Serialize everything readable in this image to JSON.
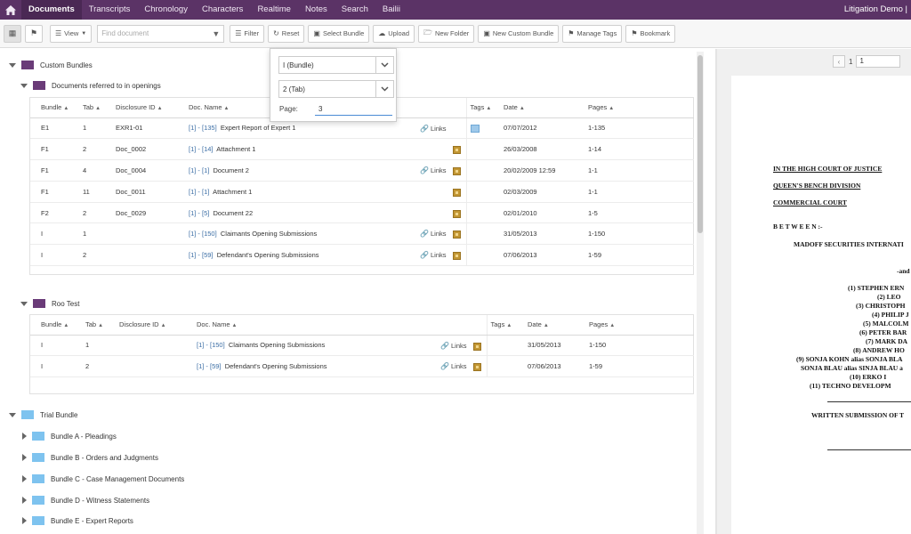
{
  "nav": {
    "items": [
      "Documents",
      "Transcripts",
      "Chronology",
      "Characters",
      "Realtime",
      "Notes",
      "Search",
      "Bailii"
    ],
    "active": "Documents",
    "right_label": "Litigation Demo |"
  },
  "toolbar": {
    "view_label": "View",
    "search_placeholder": "Find document",
    "filter_label": "Filter",
    "reset_label": "Reset",
    "select_bundle_label": "Select Bundle",
    "upload_label": "Upload",
    "new_folder_label": "New Folder",
    "new_custom_bundle_label": "New Custom Bundle",
    "manage_tags_label": "Manage Tags",
    "bookmark_label": "Bookmark"
  },
  "popup": {
    "bundle_value": "I (Bundle)",
    "tab_value": "2 (Tab)",
    "page_label": "Page:",
    "page_value": "3"
  },
  "tree": {
    "custom_bundles": "Custom Bundles",
    "docs_in_openings": "Documents referred to in openings",
    "roo_test": "Roo Test",
    "trial_bundle": "Trial Bundle",
    "sub_bundles": [
      "Bundle A - Pleadings",
      "Bundle B - Orders and Judgments",
      "Bundle C - Case Management Documents",
      "Bundle D - Witness Statements",
      "Bundle E - Expert Reports"
    ]
  },
  "table_headers": {
    "bundle": "Bundle",
    "tab": "Tab",
    "disclosure_id": "Disclosure ID",
    "doc_name": "Doc. Name",
    "tags": "Tags",
    "date": "Date",
    "pages": "Pages",
    "links": "Links"
  },
  "table1_rows": [
    {
      "bundle": "E1",
      "tab": "1",
      "disclosure": "EXR1-01",
      "ref": "[1] - [135]",
      "name": "Expert Report of Expert 1",
      "links": true,
      "tag": "blue",
      "date": "07/07/2012",
      "pages": "1-135"
    },
    {
      "bundle": "F1",
      "tab": "2",
      "disclosure": "Doc_0002",
      "ref": "[1] - [14]",
      "name": "Attachment 1",
      "links": false,
      "tag": "gold",
      "date": "26/03/2008",
      "pages": "1-14"
    },
    {
      "bundle": "F1",
      "tab": "4",
      "disclosure": "Doc_0004",
      "ref": "[1] - [1]",
      "name": "Document 2",
      "links": true,
      "tag": "gold",
      "date": "20/02/2009 12:59",
      "pages": "1-1"
    },
    {
      "bundle": "F1",
      "tab": "11",
      "disclosure": "Doc_0011",
      "ref": "[1] - [1]",
      "name": "Attachment 1",
      "links": false,
      "tag": "gold",
      "date": "02/03/2009",
      "pages": "1-1"
    },
    {
      "bundle": "F2",
      "tab": "2",
      "disclosure": "Doc_0029",
      "ref": "[1] - [5]",
      "name": "Document 22",
      "links": false,
      "tag": "gold",
      "date": "02/01/2010",
      "pages": "1-5"
    },
    {
      "bundle": "I",
      "tab": "1",
      "disclosure": "",
      "ref": "[1] - [150]",
      "name": "Claimants Opening Submissions",
      "links": true,
      "tag": "gold",
      "date": "31/05/2013",
      "pages": "1-150"
    },
    {
      "bundle": "I",
      "tab": "2",
      "disclosure": "",
      "ref": "[1] - [59]",
      "name": "Defendant's Opening Submissions",
      "links": true,
      "tag": "gold",
      "date": "07/06/2013",
      "pages": "1-59"
    }
  ],
  "table2_rows": [
    {
      "bundle": "I",
      "tab": "1",
      "disclosure": "",
      "ref": "[1] - [150]",
      "name": "Claimants Opening Submissions",
      "links": true,
      "tag": "gold",
      "date": "31/05/2013",
      "pages": "1-150"
    },
    {
      "bundle": "I",
      "tab": "2",
      "disclosure": "",
      "ref": "[1] - [59]",
      "name": "Defendant's Opening Submissions",
      "links": true,
      "tag": "gold",
      "date": "07/06/2013",
      "pages": "1-59"
    }
  ],
  "viewer": {
    "page_number": "1",
    "page_input": "1",
    "lines": [
      "IN THE HIGH COURT OF JUSTICE",
      "QUEEN'S BENCH DIVISION",
      "COMMERCIAL COURT",
      "B E T W E E N :-",
      "MADOFF SECURITIES INTERNATI",
      "-and",
      "(1)  STEPHEN ERN",
      "(2) LEO",
      "(3) CHRISTOPH",
      "(4) PHILIP J",
      "(5) MALCOLM",
      "(6) PETER BAR",
      "(7) MARK DA",
      "(8) ANDREW HO",
      "(9) SONJA KOHN alias SONJA BLA",
      "SONJA BLAU alias SINJA BLAU a",
      "(10)              ERKO I",
      "(11)         TECHNO DEVELOPM",
      "WRITTEN SUBMISSION OF T"
    ]
  },
  "colors": {
    "nav_bg": "#5b3366",
    "accent_blue": "#3b6ea5",
    "folder_purple": "#6a3b78",
    "folder_blue": "#7ec3ef",
    "tag_gold": "#c29633"
  }
}
